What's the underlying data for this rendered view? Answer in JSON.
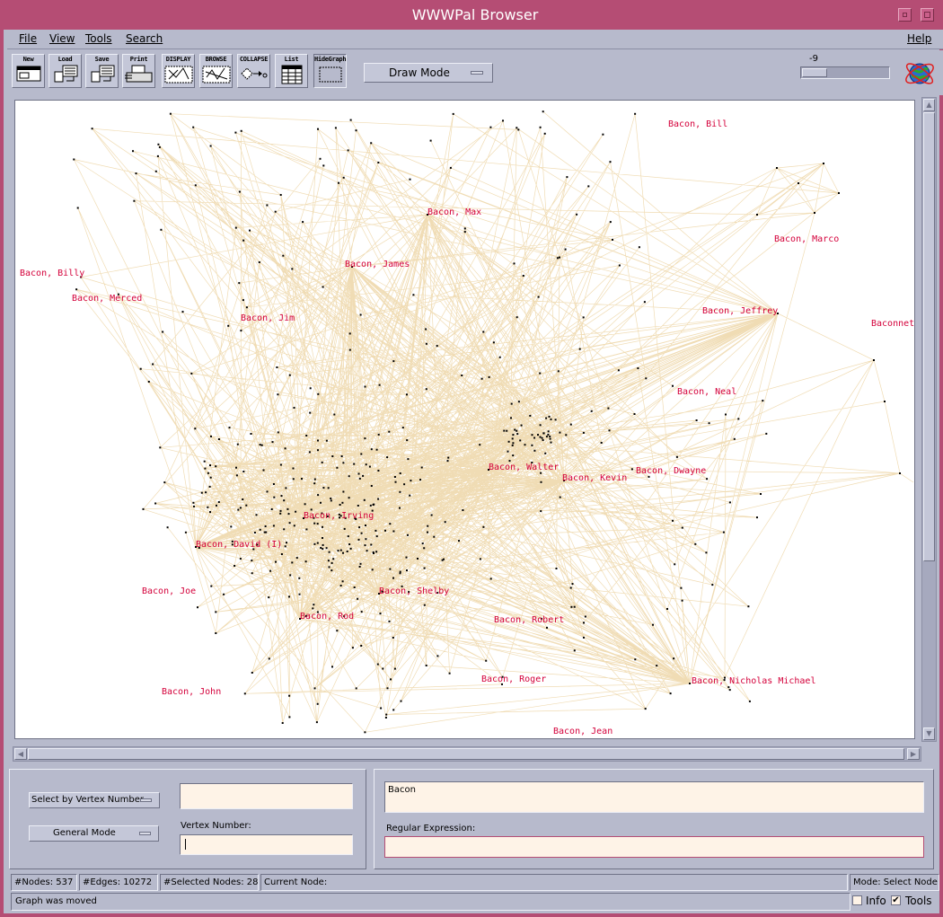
{
  "window": {
    "title": "WWWPal Browser"
  },
  "menubar": {
    "items": [
      {
        "label": "File"
      },
      {
        "label": "View"
      },
      {
        "label": "Tools"
      },
      {
        "label": "Search"
      }
    ],
    "help": "Help"
  },
  "toolbar": {
    "buttons": [
      {
        "label": "New"
      },
      {
        "label": "Load"
      },
      {
        "label": "Save"
      },
      {
        "label": "Print"
      },
      {
        "label": "DISPLAY"
      },
      {
        "label": "BROWSE"
      },
      {
        "label": "COLLAPSE"
      },
      {
        "label": "List"
      },
      {
        "label": "HideGraph"
      }
    ],
    "draw_mode": "Draw Mode",
    "slider_value": "-9"
  },
  "graph": {
    "edge_color": "#f0dcb4",
    "node_color": "#000000",
    "label_color": "#d4003a",
    "labels": [
      {
        "text": "Bacon, Bill"
      },
      {
        "text": "Bacon, Max"
      },
      {
        "text": "Bacon, Marco"
      },
      {
        "text": "Bacon, Billy"
      },
      {
        "text": "Bacon, James"
      },
      {
        "text": "Bacon, Merced"
      },
      {
        "text": "Bacon, Jim"
      },
      {
        "text": "Bacon, Jeffrey"
      },
      {
        "text": "Baconnet"
      },
      {
        "text": "Bacon, Neal"
      },
      {
        "text": "Bacon, Walter"
      },
      {
        "text": "Bacon, Kevin"
      },
      {
        "text": "Bacon, Dwayne"
      },
      {
        "text": "Bacon, Irving"
      },
      {
        "text": "Bacon, David (I)"
      },
      {
        "text": "Bacon, Joe"
      },
      {
        "text": "Bacon, Shelby"
      },
      {
        "text": "Bacon, Rod"
      },
      {
        "text": "Bacon, Robert"
      },
      {
        "text": "Bacon, Roger"
      },
      {
        "text": "Bacon, Nicholas Michael"
      },
      {
        "text": "Bacon, John"
      },
      {
        "text": "Bacon, Jean"
      }
    ]
  },
  "search_panel": {
    "select_mode": "Select by Vertex Number",
    "general_mode": "General Mode",
    "top_field_value": "",
    "vertex_number_label": "Vertex Number:",
    "vertex_number_value": "",
    "search_value": "Bacon",
    "regex_label": "Regular Expression:",
    "regex_value": ""
  },
  "status": {
    "nodes": "#Nodes:  537",
    "edges": "#Edges:  10272",
    "selected": "#Selected Nodes:  28",
    "current": "Current Node:",
    "mode": "Mode: Select Node",
    "message": "Graph was moved",
    "info_label": "Info",
    "info_checked": false,
    "tools_label": "Tools",
    "tools_checked": true
  }
}
